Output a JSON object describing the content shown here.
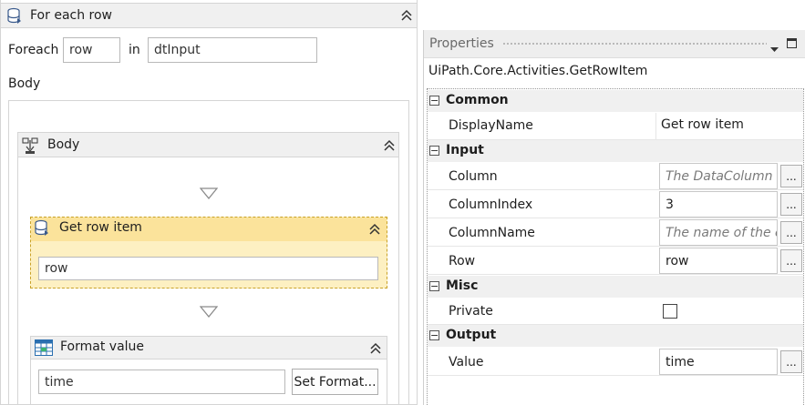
{
  "designer": {
    "foreach": {
      "title": "For each row",
      "foreach_label": "Foreach",
      "item_value": "row",
      "in_label": "in",
      "collection_value": "dtInput",
      "body_label": "Body"
    },
    "body_sequence": {
      "title": "Body"
    },
    "get_row_item": {
      "title": "Get row item",
      "row_value": "row"
    },
    "format_value": {
      "title": "Format value",
      "value": "time",
      "set_format_label": "Set Format..."
    }
  },
  "properties": {
    "panel_title": "Properties",
    "activity_type": "UiPath.Core.Activities.GetRowItem",
    "categories": {
      "common": "Common",
      "input": "Input",
      "misc": "Misc",
      "output": "Output"
    },
    "rows": {
      "display_name": {
        "label": "DisplayName",
        "value": "Get row item"
      },
      "column": {
        "label": "Column",
        "placeholder": "The DataColumn o"
      },
      "column_index": {
        "label": "ColumnIndex",
        "value": "3"
      },
      "column_name": {
        "label": "ColumnName",
        "placeholder": "The name of the co"
      },
      "row": {
        "label": "Row",
        "value": "row"
      },
      "private": {
        "label": "Private",
        "checked": false
      },
      "value": {
        "label": "Value",
        "value": "time"
      }
    },
    "ellipsis_label": "..."
  },
  "icons": [
    "database-icon",
    "sequence-icon",
    "table-grid-icon",
    "collapse-chevron-icon",
    "pin-icon",
    "dropdown-icon",
    "maximize-icon"
  ],
  "colors": {
    "selected_activity_bg": "#fdf0c2",
    "selected_activity_border": "#c9a227",
    "header_bg": "#f0f0f0",
    "category_bg": "#f0f0f0"
  }
}
